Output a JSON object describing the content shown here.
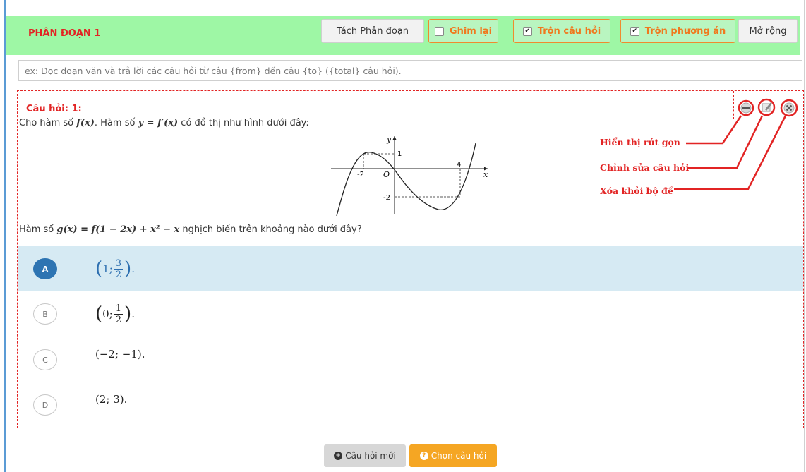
{
  "segment": {
    "title": "PHÂN ĐOẠN 1",
    "buttons": {
      "split": "Tách Phân đoạn",
      "pin": "Ghim lại",
      "shuffle_questions": "Trộn câu hỏi",
      "shuffle_answers": "Trộn phương án",
      "expand": "Mở rộng"
    },
    "checkbox_states": {
      "pin": false,
      "shuffle_questions": true,
      "shuffle_answers": true
    }
  },
  "description": {
    "placeholder": "ex: Đọc đoạn văn và trả lời các câu hỏi từ câu {from} đến câu {to} ({total} câu hỏi)."
  },
  "question": {
    "title": "Câu hỏi: 1:",
    "stem_parts": [
      "Cho hàm số ",
      "f(x)",
      ". Hàm số ",
      "y = f′(x)",
      " có đồ thị như hình dưới đây:"
    ],
    "graph_labels": {
      "y": "y",
      "x": "x",
      "origin": "O",
      "m2x": "-2",
      "x4": "4",
      "y1": "1",
      "ym2": "-2"
    },
    "stem2_parts": [
      "Hàm số ",
      "g(x) = f(1 − 2x) + x² − x",
      " nghịch biến trên khoảng nào dưới đây?"
    ],
    "options": [
      {
        "letter": "A",
        "pre": "1;",
        "num": "3",
        "den": "2",
        "selected": true
      },
      {
        "letter": "B",
        "pre": "0;",
        "num": "1",
        "den": "2",
        "selected": false
      },
      {
        "letter": "C",
        "text": "(−2; −1).",
        "selected": false
      },
      {
        "letter": "D",
        "text": "(2; 3).",
        "selected": false
      }
    ],
    "tool_icons": [
      "minus-icon",
      "edit-icon",
      "close-icon"
    ]
  },
  "annotations": {
    "collapse": "Hiển thị rút gọn",
    "edit": "Chỉnh sửa câu hỏi",
    "remove": "Xóa khỏi bộ đề"
  },
  "footer": {
    "new_question": "Câu hỏi mới",
    "choose_question": "Chọn câu hỏi"
  },
  "colors": {
    "header_bg": "#9ef7a5",
    "accent_red": "#e22424",
    "orange": "#f5a623",
    "selected_bg": "#d6eaf3",
    "option_blue": "#2d74b2"
  }
}
